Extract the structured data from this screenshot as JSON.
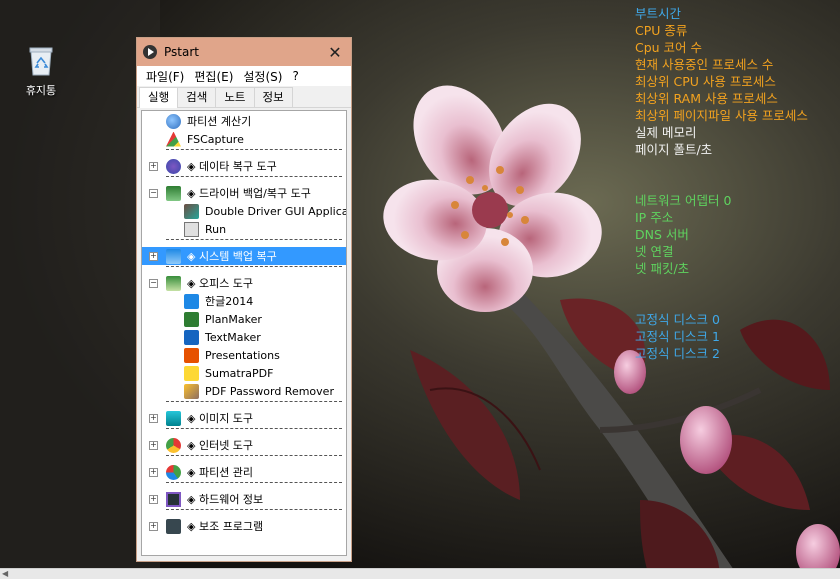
{
  "desktop": {
    "recycle_bin_label": "휴지통"
  },
  "sysinfo": [
    {
      "text": "부트시간",
      "color": "blue"
    },
    {
      "text": "CPU 종류",
      "color": "orange"
    },
    {
      "text": "Cpu 코어 수",
      "color": "orange"
    },
    {
      "text": "현재 사용중인 프로세스 수",
      "color": "orange"
    },
    {
      "text": "최상위 CPU 사용 프로세스",
      "color": "orange"
    },
    {
      "text": "최상위 RAM 사용 프로세스",
      "color": "orange"
    },
    {
      "text": "최상위 페이지파일 사용 프로세스",
      "color": "orange"
    },
    {
      "text": "실제 메모리",
      "color": "white"
    },
    {
      "text": "페이지 폴트/초",
      "color": "white"
    },
    {
      "text": "",
      "color": "white"
    },
    {
      "text": "",
      "color": "white"
    },
    {
      "text": "네트워크 어뎁터 0",
      "color": "green"
    },
    {
      "text": "  IP 주소",
      "color": "green"
    },
    {
      "text": "DNS 서버",
      "color": "green"
    },
    {
      "text": "넷 연결",
      "color": "green"
    },
    {
      "text": "넷 패킷/초",
      "color": "green"
    },
    {
      "text": "",
      "color": "green"
    },
    {
      "text": "",
      "color": "green"
    },
    {
      "text": "고정식 디스크 0",
      "color": "blue"
    },
    {
      "text": "고정식 디스크 1",
      "color": "blue"
    },
    {
      "text": "고정식 디스크 2",
      "color": "blue"
    }
  ],
  "window": {
    "title": "Pstart",
    "close_glyph": "✕",
    "menu": [
      "파일(F)",
      "편집(E)",
      "설정(S)",
      "?"
    ],
    "tabs": [
      "실행",
      "검색",
      "노트",
      "정보"
    ],
    "active_tab": 0
  },
  "tree": [
    {
      "label": "파티션 계산기",
      "level": 1,
      "icon": "partition-calc-icon",
      "exp": ""
    },
    {
      "label": "FSCapture",
      "level": 1,
      "icon": "fscapture-icon",
      "exp": ""
    },
    {
      "label": "◈ 데이타 복구 도구",
      "level": 0,
      "icon": "data-recovery-icon",
      "exp": "+",
      "sep_before": true
    },
    {
      "label": "◈ 드라이버 백업/복구 도구",
      "level": 0,
      "icon": "driver-backup-icon",
      "exp": "−",
      "sep_before": true
    },
    {
      "label": "Double Driver GUI Applica...",
      "level": 2,
      "icon": "double-driver-icon",
      "exp": ""
    },
    {
      "label": "Run",
      "level": 2,
      "icon": "run-icon",
      "exp": ""
    },
    {
      "label": "◈ 시스템 백업 복구",
      "level": 0,
      "icon": "system-backup-icon",
      "exp": "+",
      "sep_before": true,
      "selected": true
    },
    {
      "label": "◈ 오피스 도구",
      "level": 0,
      "icon": "office-tools-icon",
      "exp": "−",
      "sep_before": true
    },
    {
      "label": "한글2014",
      "level": 2,
      "icon": "hangul-icon",
      "exp": ""
    },
    {
      "label": "PlanMaker",
      "level": 2,
      "icon": "planmaker-icon",
      "exp": ""
    },
    {
      "label": "TextMaker",
      "level": 2,
      "icon": "textmaker-icon",
      "exp": ""
    },
    {
      "label": "Presentations",
      "level": 2,
      "icon": "presentations-icon",
      "exp": ""
    },
    {
      "label": "SumatraPDF",
      "level": 2,
      "icon": "sumatrapdf-icon",
      "exp": ""
    },
    {
      "label": "PDF Password Remover",
      "level": 2,
      "icon": "pdf-password-remover-icon",
      "exp": ""
    },
    {
      "label": "◈ 이미지 도구",
      "level": 0,
      "icon": "image-tools-icon",
      "exp": "+",
      "sep_before": true
    },
    {
      "label": "◈ 인터넷 도구",
      "level": 0,
      "icon": "internet-tools-icon",
      "exp": "+",
      "sep_before": true
    },
    {
      "label": "◈ 파티션 관리",
      "level": 0,
      "icon": "partition-manager-icon",
      "exp": "+",
      "sep_before": true
    },
    {
      "label": "◈ 하드웨어 정보",
      "level": 0,
      "icon": "hardware-info-icon",
      "exp": "+",
      "sep_before": true
    },
    {
      "label": "◈ 보조 프로그램",
      "level": 0,
      "icon": "accessories-icon",
      "exp": "+",
      "sep_before": true
    }
  ]
}
